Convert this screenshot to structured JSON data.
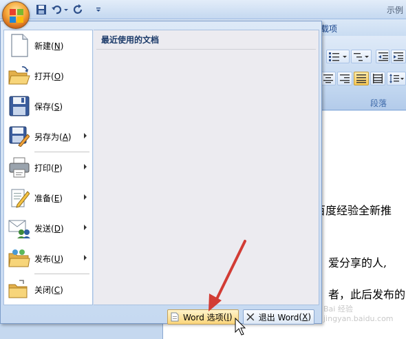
{
  "window": {
    "title_fragment": "示例",
    "ribbon_tab_fragment": "载项",
    "group_label": "段落"
  },
  "office_menu": {
    "items": [
      {
        "label": "新建",
        "key": "N",
        "icon": "new-document-icon",
        "has_submenu": false
      },
      {
        "label": "打开",
        "key": "O",
        "icon": "open-folder-icon",
        "has_submenu": false
      },
      {
        "label": "保存",
        "key": "S",
        "icon": "save-disk-icon",
        "has_submenu": false
      },
      {
        "label": "另存为",
        "key": "A",
        "icon": "save-as-icon",
        "has_submenu": true
      },
      {
        "label": "打印",
        "key": "P",
        "icon": "printer-icon",
        "has_submenu": true
      },
      {
        "label": "准备",
        "key": "E",
        "icon": "prepare-pencil-icon",
        "has_submenu": true
      },
      {
        "label": "发送",
        "key": "D",
        "icon": "send-icon",
        "has_submenu": true
      },
      {
        "label": "发布",
        "key": "U",
        "icon": "publish-folder-icon",
        "has_submenu": true
      },
      {
        "label": "关闭",
        "key": "C",
        "icon": "close-folder-icon",
        "has_submenu": false
      }
    ],
    "recent_title": "最近使用的文档",
    "word_options": {
      "label": "Word 选项",
      "key": "I"
    },
    "exit_word": {
      "label": "退出 Word",
      "key": "X"
    }
  },
  "document": {
    "lines": [
      "百度经验全新推",
      "爱分享的人,",
      "者，此后发布的"
    ]
  },
  "watermark": "Bai 经验 jingyan.baidu.com",
  "colors": {
    "ribbon_blue": "#c5d8ef",
    "menu_highlight": "#fbd57a",
    "annotation_red": "#d23c35"
  }
}
